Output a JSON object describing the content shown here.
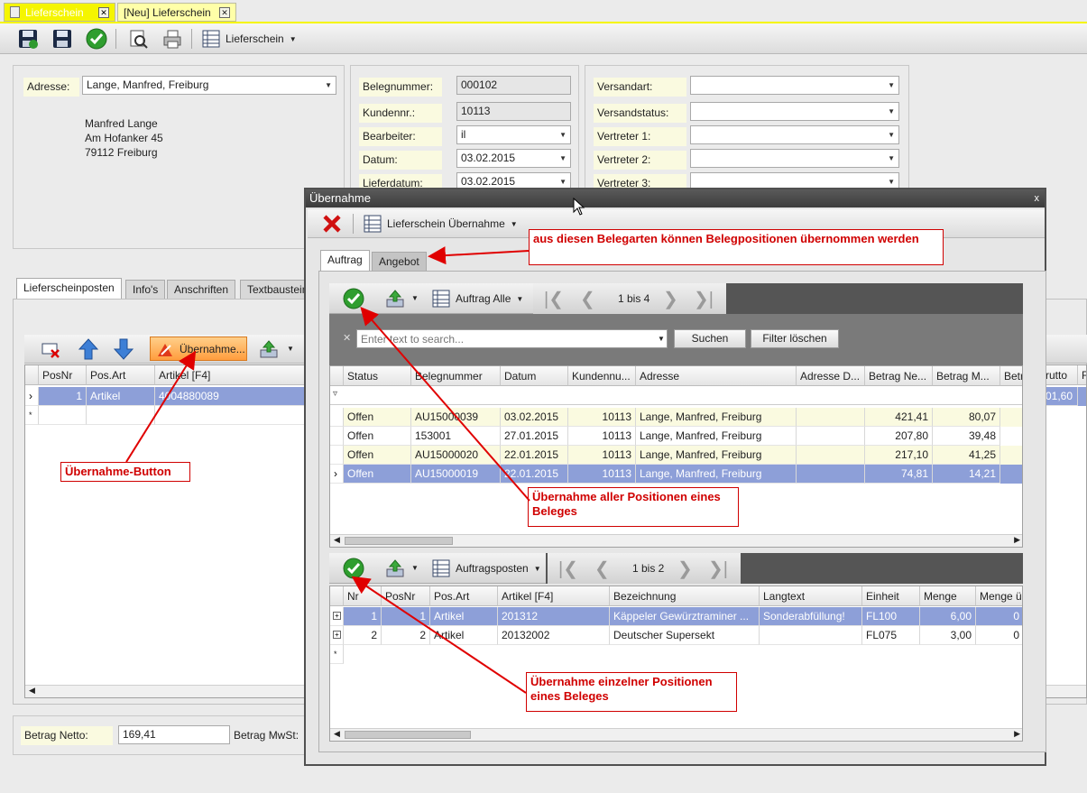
{
  "doc_tabs": [
    {
      "label": "Lieferschein"
    },
    {
      "label": "[Neu] Lieferschein"
    }
  ],
  "main_toolbar": {
    "view_label": "Lieferschein"
  },
  "address": {
    "label": "Adresse:",
    "value": "Lange, Manfred, Freiburg",
    "lines": [
      "Manfred Lange",
      "Am Hofanker  45",
      "79112 Freiburg"
    ]
  },
  "fields_mid": [
    {
      "label": "Belegnummer:",
      "value": "000102"
    },
    {
      "label": "Kundennr.:",
      "value": "10113"
    },
    {
      "label": "Bearbeiter:",
      "value": "il"
    },
    {
      "label": "Datum:",
      "value": "03.02.2015"
    },
    {
      "label": "Lieferdatum:",
      "value": "03.02.2015"
    }
  ],
  "fields_right": [
    {
      "label": "Versandart:",
      "value": ""
    },
    {
      "label": "Versandstatus:",
      "value": ""
    },
    {
      "label": "Vertreter 1:",
      "value": ""
    },
    {
      "label": "Vertreter 2:",
      "value": ""
    },
    {
      "label": "Vertreter 3:",
      "value": ""
    }
  ],
  "section_tabs": [
    "Lieferscheinposten",
    "Info's",
    "Anschriften",
    "Textbausteine"
  ],
  "positions_toolbar": {
    "uebernahme_label": "Übernahme..."
  },
  "positions_grid": {
    "headers": [
      "PosNr",
      "Pos.Art",
      "Artikel [F4]"
    ],
    "rows": [
      {
        "posnr": "1",
        "posart": "Artikel",
        "artikel": "4004880089"
      }
    ],
    "right_headers": [
      "rutto",
      "F"
    ],
    "right_value": "01,60"
  },
  "footer": {
    "netto_label": "Betrag Netto:",
    "netto_value": "169,41",
    "mwst_label": "Betrag MwSt:"
  },
  "dialog": {
    "title": "Übernahme",
    "toolbar_label": "Lieferschein Übernahme",
    "tabs": [
      "Auftrag",
      "Angebot"
    ],
    "upper_nav": {
      "view_label": "Auftrag Alle",
      "page": "1 bis 4"
    },
    "search": {
      "placeholder": "Enter text to search...",
      "search_btn": "Suchen",
      "clear_btn": "Filter löschen"
    },
    "upper_grid": {
      "headers": [
        "Status",
        "Belegnummer",
        "Datum",
        "Kundennu...",
        "Adresse",
        "Adresse D...",
        "Betrag Ne...",
        "Betrag M...",
        "Betr"
      ],
      "rows": [
        [
          "Offen",
          "AU15000039",
          "03.02.2015",
          "10113",
          "Lange, Manfred, Freiburg",
          "",
          "421,41",
          "80,07"
        ],
        [
          "Offen",
          "153001",
          "27.01.2015",
          "10113",
          "Lange, Manfred, Freiburg",
          "",
          "207,80",
          "39,48"
        ],
        [
          "Offen",
          "AU15000020",
          "22.01.2015",
          "10113",
          "Lange, Manfred, Freiburg",
          "",
          "217,10",
          "41,25"
        ],
        [
          "Offen",
          "AU15000019",
          "22.01.2015",
          "10113",
          "Lange, Manfred, Freiburg",
          "",
          "74,81",
          "14,21"
        ]
      ]
    },
    "lower_nav": {
      "view_label": "Auftragsposten",
      "page": "1 bis 2"
    },
    "lower_grid": {
      "headers": [
        "Nr",
        "PosNr",
        "Pos.Art",
        "Artikel [F4]",
        "Bezeichnung",
        "Langtext",
        "Einheit",
        "Menge",
        "Menge ü"
      ],
      "rows": [
        [
          "1",
          "1",
          "Artikel",
          "201312",
          "Käppeler Gewürztraminer ...",
          "Sonderabfüllung!",
          "FL100",
          "6,00",
          "0"
        ],
        [
          "2",
          "2",
          "Artikel",
          "20132002",
          "Deutscher Supersekt",
          "",
          "FL075",
          "3,00",
          "0"
        ]
      ]
    }
  },
  "callouts": {
    "belegarten": "aus diesen Belegarten können Belegpositionen übernommen werden",
    "button": "Übernahme-Button",
    "alle": "Übernahme aller Positionen eines Beleges",
    "einzeln": "Übernahme einzelner  Positionen eines Beleges"
  },
  "colors": {
    "accent_yellow": "#f5f500",
    "selection": "#8d9fd8",
    "callout_red": "#d00000",
    "row_cream": "#fafae0"
  }
}
